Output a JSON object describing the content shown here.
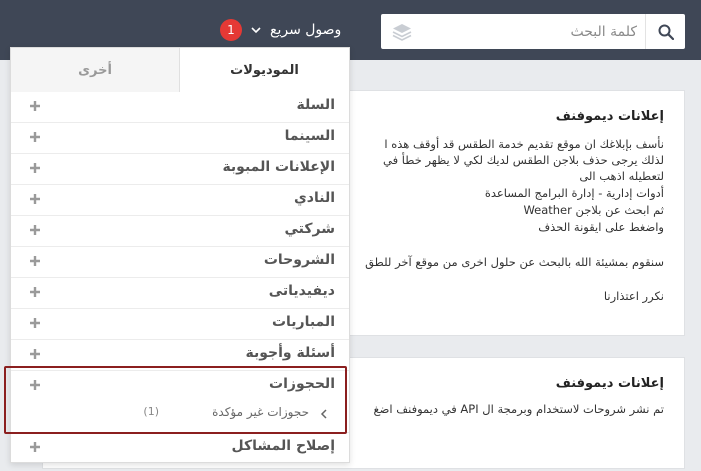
{
  "topbar": {
    "search": {
      "placeholder": "كلمة البحث"
    },
    "quick_access": {
      "label": "وصول سريع",
      "badge": "1"
    }
  },
  "dropdown": {
    "tabs": {
      "active": "الموديولات",
      "other": "أخرى"
    },
    "items": [
      {
        "label": "السلة"
      },
      {
        "label": "السينما"
      },
      {
        "label": "الإعلانات المبوبة"
      },
      {
        "label": "النادي"
      },
      {
        "label": "شركتي"
      },
      {
        "label": "الشروحات"
      },
      {
        "label": "ديفيدياتى"
      },
      {
        "label": "المباريات"
      },
      {
        "label": "أسئلة وأجوبة"
      },
      {
        "label": "الحجوزات"
      },
      {
        "label": "إصلاح المشاكل"
      }
    ],
    "sub_item": {
      "label": "حجوزات غير مؤكدة",
      "count": "(1)"
    }
  },
  "cards": {
    "card1": {
      "title": "إعلانات ديموفنف",
      "lines": [
        "نأسف بإبلاغك ان موقع تقديم خدمة الطقس قد أوقف هذه ا",
        "لذلك يرجى حذف بلاجن الطقس لديك لكي لا يظهر خطأ في",
        "لتعطيله اذهب الى",
        "أدوات إدارية - إدارة البرامج المساعدة",
        "ثم ابحث عن بلاجن Weather",
        "واضغط على ايقونة الحذف",
        "سنقوم بمشيئة الله بالبحث عن حلول اخرى من موقع آخر للطق",
        "نكرر اعتذارنا"
      ]
    },
    "card2": {
      "title": "إعلانات ديموفنف",
      "lines": [
        "تم نشر شروحات لاستخدام وبرمجة ال API في ديموفنف اضغ"
      ]
    }
  },
  "colors": {
    "topbar": "#3f4756",
    "badge": "#e53935",
    "highlight": "#8b1f1f"
  }
}
